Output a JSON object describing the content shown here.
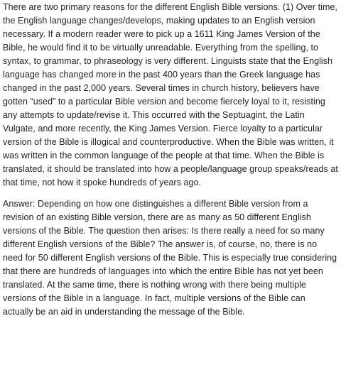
{
  "paragraphs": [
    "There are two primary reasons for the different English Bible versions. (1) Over time, the English language changes/develops, making updates to an English version necessary. If a modern reader were to pick up a 1611 King James Version of the Bible, he would find it to be virtually unreadable. Everything from the spelling, to syntax, to grammar, to phraseology is very different. Linguists state that the English language has changed more in the past 400 years than the Greek language has changed in the past 2,000 years. Several times in church history, believers have gotten “used” to a particular Bible version and become fiercely loyal to it, resisting any attempts to update/revise it. This occurred with the Septuagint, the Latin Vulgate, and more recently, the King James Version. Fierce loyalty to a particular version of the Bible is illogical and counterproductive. When the Bible was written, it was written in the common language of the people at that time. When the Bible is translated, it should be translated into how a people/language group speaks/reads at that time, not how it spoke hundreds of years ago.",
    "Answer: Depending on how one distinguishes a different Bible version from a revision of an existing Bible version, there are as many as 50 different English versions of the Bible. The question then arises: Is there really a need for so many different English versions of the Bible? The answer is, of course, no, there is no need for 50 different English versions of the Bible. This is especially true considering that there are hundreds of languages into which the entire Bible has not yet been translated. At the same time, there is nothing wrong with there being multiple versions of the Bible in a language. In fact, multiple versions of the Bible can actually be an aid in understanding the message of the Bible."
  ]
}
